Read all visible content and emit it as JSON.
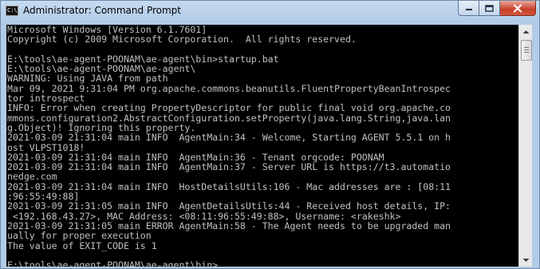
{
  "window": {
    "title": "Administrator: Command Prompt",
    "icon_name": "cmd-icon",
    "icon_glyph": "C:\\"
  },
  "colors": {
    "console_background": "#000000",
    "console_text": "#c0c0c0",
    "title_bar": "#b9d1ea",
    "close_button": "#c7402a"
  },
  "console_lines": [
    "Microsoft Windows [Version 6.1.7601]",
    "Copyright (c) 2009 Microsoft Corporation.  All rights reserved.",
    "",
    "E:\\tools\\ae-agent-POONAM\\ae-agent\\bin>startup.bat",
    "E:\\tools\\ae-agent-POONAM\\ae-agent\\",
    "WARNING: Using JAVA from path",
    "Mar 09, 2021 9:31:04 PM org.apache.commons.beanutils.FluentPropertyBeanIntrospec",
    "tor introspect",
    "INFO: Error when creating PropertyDescriptor for public final void org.apache.co",
    "mmons.configuration2.AbstractConfiguration.setProperty(java.lang.String,java.lan",
    "g.Object)! Ignoring this property.",
    "2021-03-09 21:31:04 main INFO  AgentMain:34 - Welcome, Starting AGENT 5.5.1 on h",
    "ost VLPST1018!",
    "2021-03-09 21:31:04 main INFO  AgentMain:36 - Tenant orgcode: POONAM",
    "2021-03-09 21:31:04 main INFO  AgentMain:37 - Server URL is https://t3.automatio",
    "nedge.com",
    "2021-03-09 21:31:04 main INFO  HostDetailsUtils:106 - Mac addresses are : [08:11",
    ":96:55:49:88]",
    "2021-03-09 21:31:05 main INFO  AgentDetailsUtils:44 - Received host details, IP:",
    " <192.168.43.27>, MAC Address: <08:11:96:55:49:88>, Username: <rakeshk>",
    "2021-03-09 21:31:05 main ERROR AgentMain:58 - The Agent needs to be upgraded man",
    "ually for proper execution",
    "The value of EXIT_CODE is 1",
    "",
    "E:\\tools\\ae-agent-POONAM\\ae-agent\\bin>"
  ]
}
